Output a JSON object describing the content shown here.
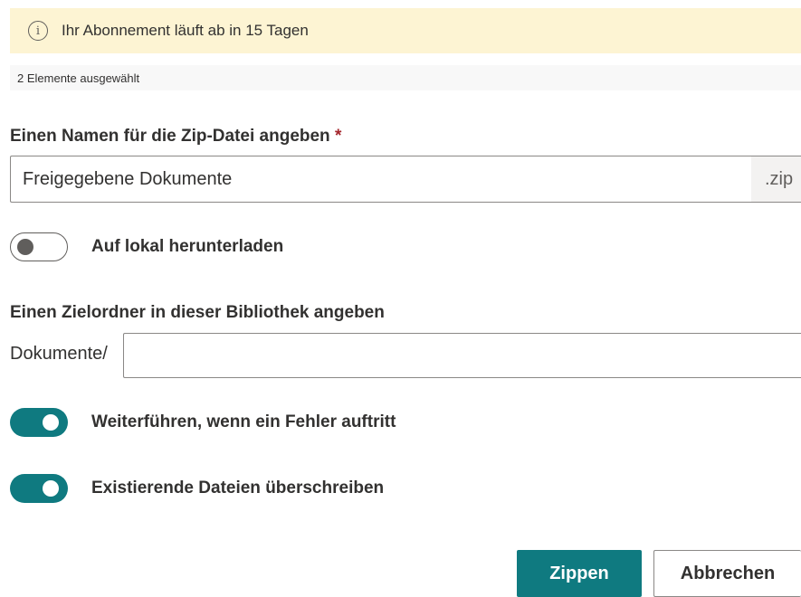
{
  "notice": {
    "icon": "info-icon",
    "text": "Ihr Abonnement läuft ab in 15 Tagen",
    "color": "#fdf4d3"
  },
  "selection": {
    "text": "2 Elemente ausgewählt"
  },
  "zip": {
    "label": "Einen Namen für die Zip-Datei angeben",
    "required_marker": "*",
    "value": "Freigegebene Dokumente",
    "suffix": ".zip"
  },
  "download_local": {
    "label": "Auf lokal herunterladen",
    "on": false
  },
  "target": {
    "label": "Einen Zielordner in dieser Bibliothek angeben",
    "prefix": "Dokumente/",
    "value": ""
  },
  "continue_on_error": {
    "label": "Weiterführen, wenn ein Fehler auftritt",
    "on": true
  },
  "overwrite": {
    "label": "Existierende Dateien überschreiben",
    "on": true
  },
  "buttons": {
    "primary": "Zippen",
    "secondary": "Abbrechen"
  },
  "colors": {
    "accent": "#0f7a80",
    "required": "#a4262c"
  }
}
